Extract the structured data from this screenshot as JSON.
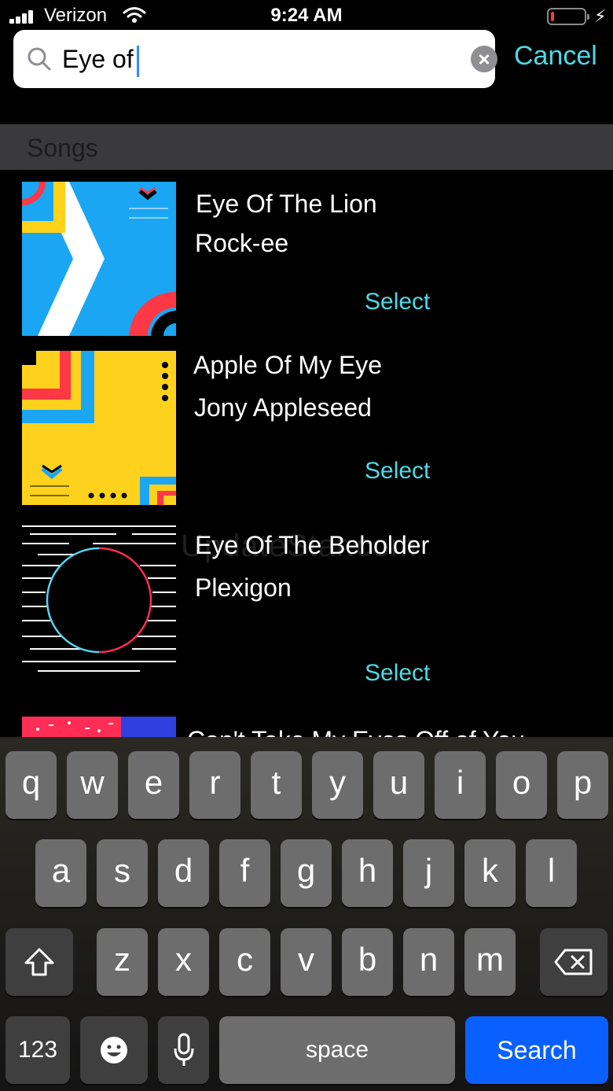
{
  "status_bar": {
    "carrier": "Verizon",
    "time": "9:24 AM",
    "battery_level": 0.08
  },
  "search": {
    "value": "Eye of",
    "cancel_label": "Cancel"
  },
  "section": {
    "title": "Songs"
  },
  "songs": [
    {
      "title": "Eye Of The Lion",
      "artist": "Rock-ee",
      "action": "Select"
    },
    {
      "title": "Apple Of My Eye",
      "artist": "Jony Appleseed",
      "action": "Select"
    },
    {
      "title": "Eye Of The Beholder",
      "artist": "Plexigon",
      "action": "Select"
    },
    {
      "title": "Can't Take My Eyes Off of You",
      "artist": "",
      "action": ""
    }
  ],
  "watermark": "UpdateStar.com",
  "keyboard": {
    "row1": [
      "q",
      "w",
      "e",
      "r",
      "t",
      "y",
      "u",
      "i",
      "o",
      "p"
    ],
    "row2": [
      "a",
      "s",
      "d",
      "f",
      "g",
      "h",
      "j",
      "k",
      "l"
    ],
    "row3": [
      "z",
      "x",
      "c",
      "v",
      "b",
      "n",
      "m"
    ],
    "numbers_label": "123",
    "space_label": "space",
    "search_label": "Search"
  },
  "colors": {
    "accent": "#4fd9e6",
    "search_key": "#0a60ff"
  }
}
